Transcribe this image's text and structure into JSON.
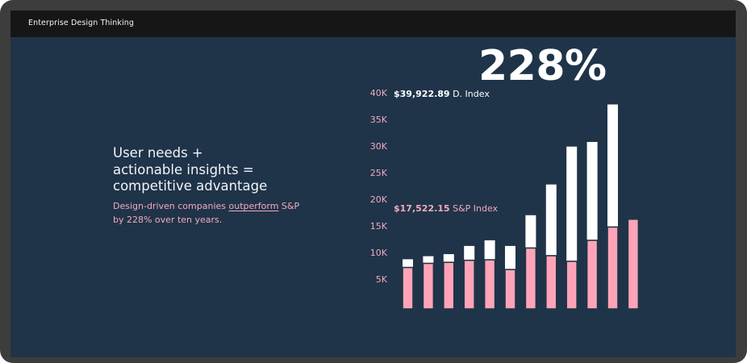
{
  "topbar": {
    "title": "Enterprise Design Thinking"
  },
  "hero": {
    "headline_lines": [
      "User needs +",
      "actionable insights =",
      "competitive advantage"
    ],
    "sub_before": "Design-driven companies ",
    "sub_link": "outperform",
    "sub_after": " S&P by 228% over ten years."
  },
  "stat": {
    "value": "228%"
  },
  "annotations": {
    "design_index": {
      "value": "$39,922.89",
      "label": " D. Index"
    },
    "sp_index": {
      "value": "$17,522.15",
      "label": " S&P Index"
    }
  },
  "colors": {
    "background": "#1f3449",
    "design_index": "#ffffff",
    "sp_index": "#ffa4b8",
    "axis_text": "#f4a9bd"
  },
  "chart_data": {
    "type": "bar",
    "stacked": true,
    "x": [
      1,
      2,
      3,
      4,
      5,
      6,
      7,
      8,
      9,
      10,
      11,
      12
    ],
    "ylim": [
      0,
      40000
    ],
    "yticks": [
      {
        "value": 40000,
        "label": "40K"
      },
      {
        "value": 35000,
        "label": "35K"
      },
      {
        "value": 30000,
        "label": "30K"
      },
      {
        "value": 25000,
        "label": "25K"
      },
      {
        "value": 20000,
        "label": "20K"
      },
      {
        "value": 15000,
        "label": "15K"
      },
      {
        "value": 10000,
        "label": "10K"
      },
      {
        "value": 5000,
        "label": "5K"
      }
    ],
    "series": [
      {
        "name": "S&P Index",
        "color": "#ffa4b8",
        "values": [
          8100,
          8900,
          9100,
          9500,
          9600,
          7700,
          11900,
          10400,
          9300,
          13400,
          16000,
          17522
        ]
      },
      {
        "name": "D. Index",
        "color": "#ffffff",
        "values": [
          9700,
          10300,
          10700,
          12300,
          13400,
          12300,
          18300,
          24300,
          31700,
          32600,
          39923
        ]
      }
    ]
  }
}
